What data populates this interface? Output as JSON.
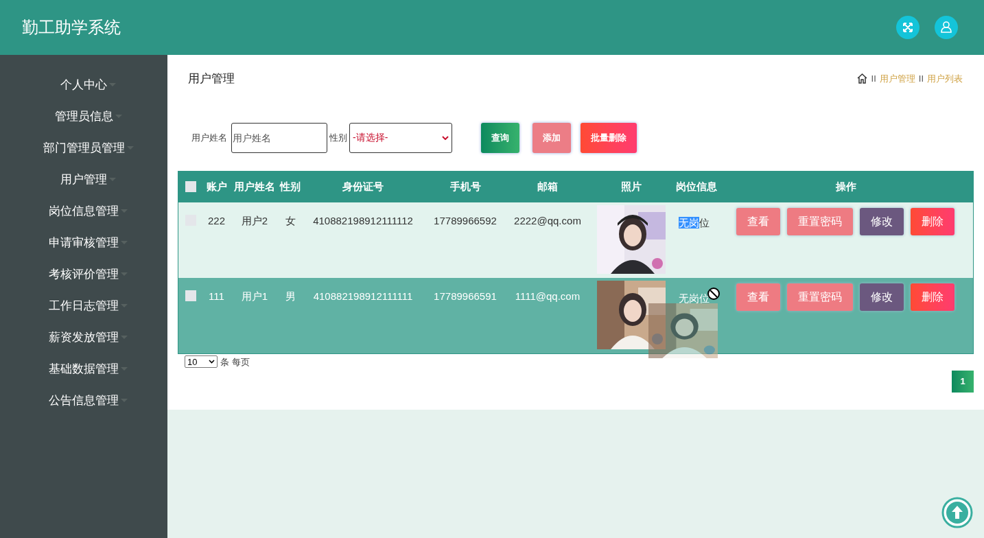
{
  "header": {
    "title": "勤工助学系统"
  },
  "sidebar": {
    "items": [
      {
        "label": "个人中心"
      },
      {
        "label": "管理员信息"
      },
      {
        "label": "部门管理员管理"
      },
      {
        "label": "用户管理"
      },
      {
        "label": "岗位信息管理"
      },
      {
        "label": "申请审核管理"
      },
      {
        "label": "考核评价管理"
      },
      {
        "label": "工作日志管理"
      },
      {
        "label": "薪资发放管理"
      },
      {
        "label": "基础数据管理"
      },
      {
        "label": "公告信息管理"
      }
    ]
  },
  "page_title": "用户管理",
  "breadcrumb": [
    {
      "separator": "II",
      "label": "用户管理"
    },
    {
      "separator": "II",
      "label": "用户列表"
    }
  ],
  "search": {
    "name_label": "用户姓名",
    "name_placeholder": "用户姓名",
    "gender_label": "性别",
    "gender_value": "-请选择-"
  },
  "actions": [
    "查询",
    "添加",
    "批量删除"
  ],
  "table": {
    "select_all_checked": false,
    "columns": [
      "账户",
      "用户姓名",
      "性别",
      "身份证号",
      "手机号",
      "邮箱",
      "照片",
      "岗位信息",
      "操作"
    ],
    "rows": [
      {
        "account": "222",
        "name": "用户2",
        "gender": "女",
        "id_number": "410882198912111112",
        "phone": "17789966592",
        "email": "2222@qq.com",
        "photo": {
          "kind": "picture"
        },
        "job": [
          {
            "text": "无岗",
            "selected": true
          },
          {
            "text": "位",
            "selected": false
          }
        ],
        "checked": false,
        "highlighted": false,
        "buttons": [
          "查看",
          "重置密码",
          "修改",
          "删除"
        ]
      },
      {
        "account": "111",
        "name": "用户1",
        "gender": "男",
        "id_number": "410882198912111111",
        "phone": "17789966591",
        "email": "1111@qq.com",
        "photo": {
          "kind": "picture"
        },
        "job": [
          {
            "text": "无岗位",
            "selected": false
          }
        ],
        "checked": false,
        "highlighted": true,
        "buttons": [
          "查看",
          "重置密码",
          "修改",
          "删除"
        ]
      }
    ]
  },
  "page_size": {
    "value": "10",
    "suffix": "条 每页"
  },
  "pages": [
    {
      "label": "1",
      "selected": true
    }
  ]
}
